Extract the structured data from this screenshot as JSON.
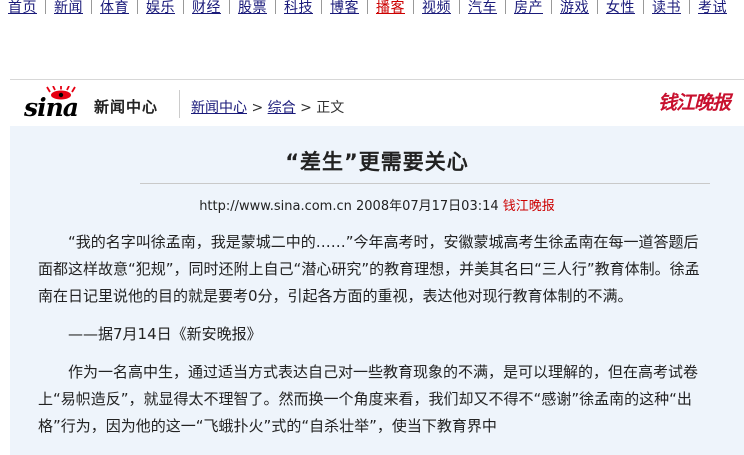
{
  "nav": {
    "items": [
      {
        "label": "首页",
        "hot": false
      },
      {
        "label": "新闻",
        "hot": false
      },
      {
        "label": "体育",
        "hot": false
      },
      {
        "label": "娱乐",
        "hot": false
      },
      {
        "label": "财经",
        "hot": false
      },
      {
        "label": "股票",
        "hot": false
      },
      {
        "label": "科技",
        "hot": false
      },
      {
        "label": "博客",
        "hot": false
      },
      {
        "label": "播客",
        "hot": true
      },
      {
        "label": "视频",
        "hot": false
      },
      {
        "label": "汽车",
        "hot": false
      },
      {
        "label": "房产",
        "hot": false
      },
      {
        "label": "游戏",
        "hot": false
      },
      {
        "label": "女性",
        "hot": false
      },
      {
        "label": "读书",
        "hot": false
      },
      {
        "label": "考试",
        "hot": false
      }
    ]
  },
  "header": {
    "logo_text": "sina",
    "logo_sub": "新闻中心",
    "breadcrumb": {
      "home": "新闻中心",
      "section": "综合",
      "current": "正文",
      "sep": " > "
    },
    "paper_logo": "钱江晚报"
  },
  "article": {
    "title": "“差生”更需要关心",
    "meta_url": "http://www.sina.com.cn",
    "meta_time": "2008年07月17日03:14",
    "meta_source": "钱江晚报",
    "paragraphs": [
      "“我的名字叫徐孟南，我是蒙城二中的……”今年高考时，安徽蒙城高考生徐孟南在每一道答题后面都这样故意“犯规”，同时还附上自己“潜心研究”的教育理想，并美其名曰“三人行”教育体制。徐孟南在日记里说他的目的就是要考0分，引起各方面的重视，表达他对现行教育体制的不满。",
      "——据7月14日《新安晚报》",
      "作为一名高中生，通过适当方式表达自己对一些教育现象的不满，是可以理解的，但在高考试卷上“易帜造反”，就显得太不理智了。然而换一个角度来看，我们却又不得不“感谢”徐孟南的这种“出格”行为，因为他的这一“飞蛾扑火”式的“自杀壮举”，使当下教育界中"
    ]
  }
}
